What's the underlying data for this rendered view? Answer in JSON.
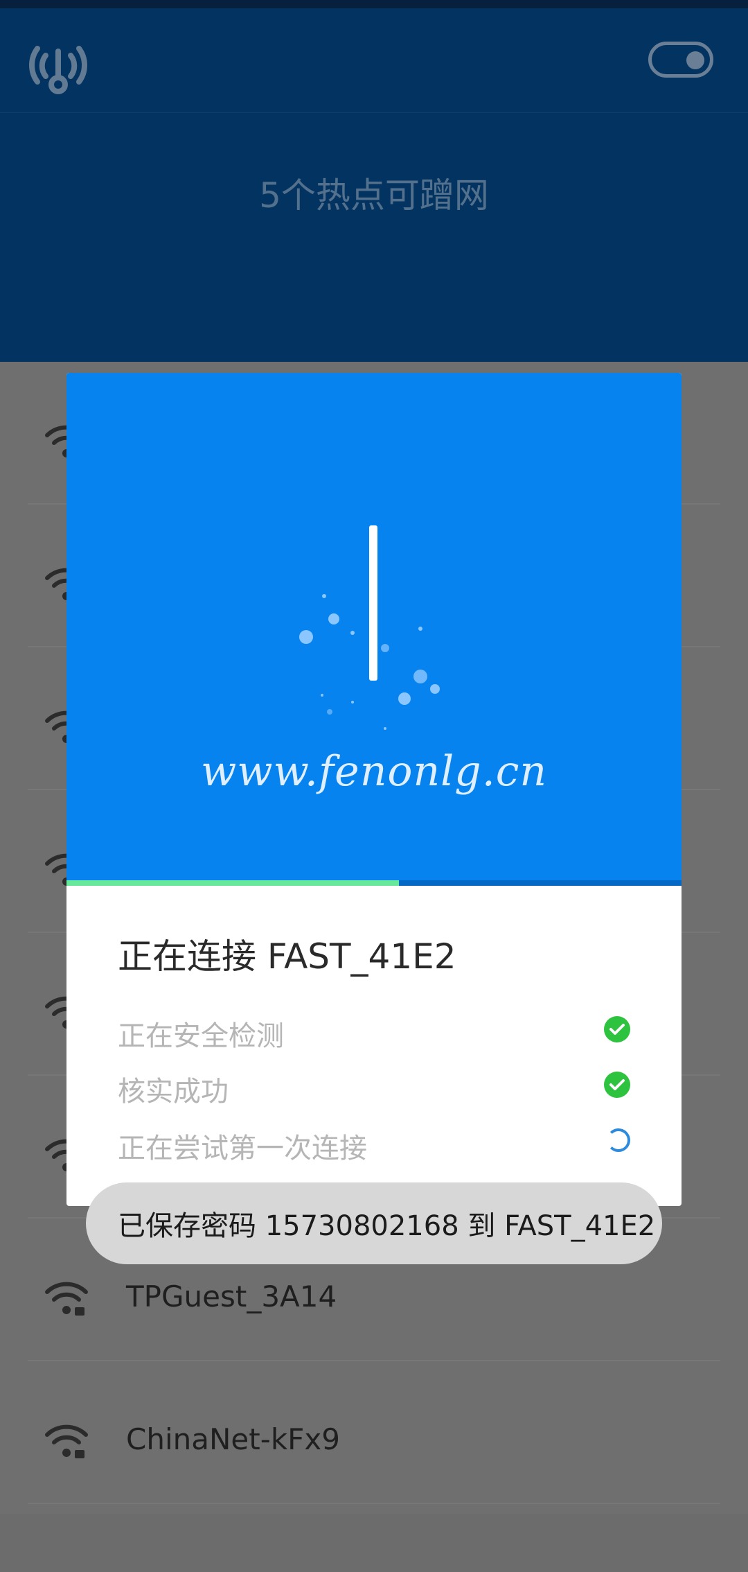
{
  "header": {
    "hotspot_count": "5个热点可蹭网"
  },
  "network_list": [
    {
      "name": ""
    },
    {
      "name": ""
    },
    {
      "name": ""
    },
    {
      "name": ""
    },
    {
      "name": ""
    },
    {
      "name": ""
    },
    {
      "name": "TPGuest_3A14"
    },
    {
      "name": "ChinaNet-kFx9"
    }
  ],
  "dialog": {
    "watermark": "www.fenonlg.cn",
    "progress_fraction": 0.54,
    "title": "正在连接 FAST_41E2",
    "steps": [
      {
        "label": "正在安全检测",
        "status": "done"
      },
      {
        "label": "核实成功",
        "status": "done"
      },
      {
        "label": "正在尝试第一次连接",
        "status": "loading"
      }
    ]
  },
  "toast": {
    "text": "已保存密码 15730802168 到 FAST_41E2"
  },
  "colors": {
    "header_bg": "#033461",
    "dialog_hero_bg": "#0683ee",
    "progress_fill": "#67e89a",
    "check_green": "#2ec33e"
  }
}
